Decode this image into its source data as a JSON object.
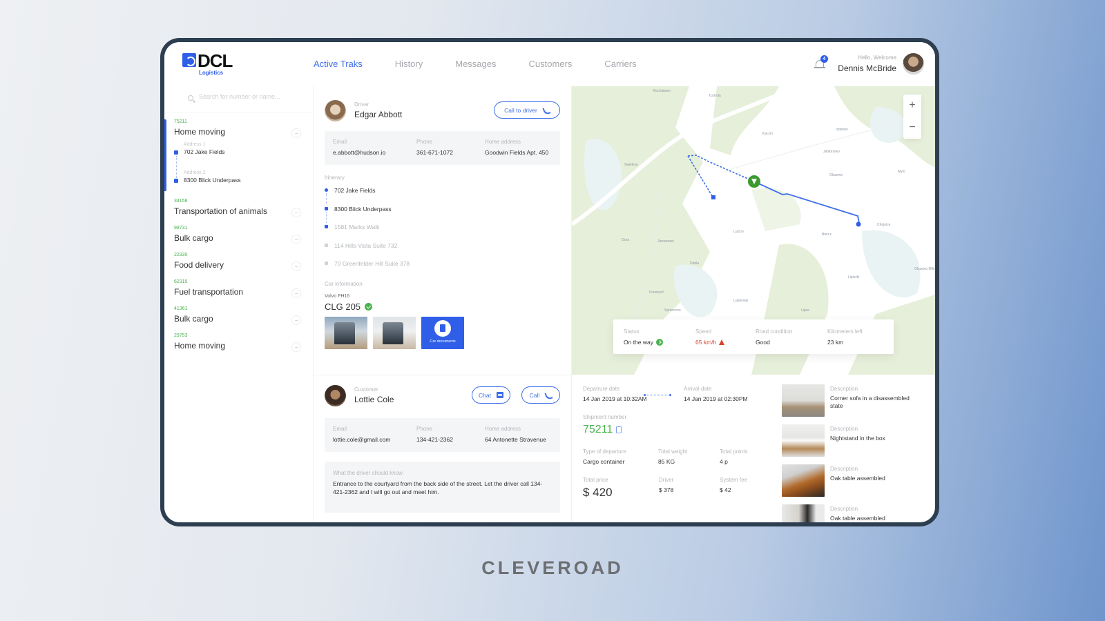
{
  "brand": {
    "logo_text": "DCL",
    "logo_sub": "Logistics",
    "footer": "CLEVEROAD"
  },
  "nav": {
    "items": [
      {
        "label": "Active Traks",
        "active": true
      },
      {
        "label": "History",
        "active": false
      },
      {
        "label": "Messages",
        "active": false
      },
      {
        "label": "Customers",
        "active": false
      },
      {
        "label": "Carriers",
        "active": false
      }
    ]
  },
  "user": {
    "notifications": "4",
    "greeting": "Hello, Welcome",
    "name": "Dennis McBride"
  },
  "sidebar": {
    "search_placeholder": "Search for number or name...",
    "trips": [
      {
        "number": "75211",
        "title": "Home moving",
        "active": true,
        "addresses": [
          {
            "label": "Address 1",
            "value": "702 Jake Fields"
          },
          {
            "label": "Address 2",
            "value": "8300 Blick Underpass"
          }
        ]
      },
      {
        "number": "34156",
        "title": "Transportation of animals"
      },
      {
        "number": "98731",
        "title": "Bulk cargo"
      },
      {
        "number": "22330",
        "title": "Food delivery"
      },
      {
        "number": "62315",
        "title": "Fuel transportation"
      },
      {
        "number": "41361",
        "title": "Bulk cargo"
      },
      {
        "number": "29753",
        "title": "Home moving"
      }
    ]
  },
  "driver": {
    "role": "Driver",
    "name": "Edgar Abbott",
    "call_label": "Call to driver",
    "email_label": "Email",
    "email": "e.abbott@hudson.io",
    "phone_label": "Phone",
    "phone": "361-671-1072",
    "address_label": "Home address",
    "address": "Goodwin Fields Apt. 450"
  },
  "itinerary": {
    "label": "Itinerary",
    "stops": [
      {
        "value": "702 Jake Fields",
        "state": "done"
      },
      {
        "value": "8300 Blick Underpass",
        "state": "done"
      },
      {
        "value": "1581 Marks Walk",
        "state": "next"
      },
      {
        "value": "114 Hills Vista Suite 732",
        "state": "pending"
      },
      {
        "value": "70 Greenfelder Hill Suite 378",
        "state": "pending"
      }
    ]
  },
  "car": {
    "label": "Car information",
    "model": "Volvo FH16",
    "plate": "CLG 205",
    "documents_label": "Car documents"
  },
  "customer": {
    "role": "Customer",
    "name": "Lottie Cole",
    "chat_label": "Chat",
    "call_label": "Call",
    "email_label": "Email",
    "email": "lottie.cole@gmail.com",
    "phone_label": "Phone",
    "phone": "134-421-2362",
    "address_label": "Home address",
    "address": "64 Antonette Stravenue",
    "note_label": "What the driver should know",
    "note": "Entrance to the courtyard from the back side of the street. Let the driver call 134-421-2362 and I will go out and meet him."
  },
  "map": {
    "zoom_in": "+",
    "zoom_out": "−",
    "places": [
      "Bochatowo",
      "Tuchola",
      "Kaczin",
      "Izdebno",
      "Jabłonowo",
      "Swiekow",
      "Olszewo",
      "Mylo",
      "Lulzon",
      "Biercz",
      "Chojnice",
      "Gora",
      "Jaroszewo",
      "Dobla",
      "Przemyśl",
      "Lubieniak",
      "Sprzeczno",
      "Lipiczki",
      "Lipce",
      "Olszewo Mile"
    ],
    "status": {
      "status_label": "Status",
      "status_value": "On the way",
      "speed_label": "Speed",
      "speed_value": "65 km/h",
      "road_label": "Road condition",
      "road_value": "Good",
      "km_label": "Kilometers left",
      "km_value": "23 km"
    }
  },
  "shipment": {
    "departure_label": "Depatrure date",
    "departure": "14 Jan 2019 at 10:32AM",
    "arrival_label": "Arrival date",
    "arrival": "14 Jan 2019 at 02:30PM",
    "number_label": "Shipment number",
    "number": "75211",
    "type_label": "Type of departure",
    "type": "Cargo container",
    "weight_label": "Total weight",
    "weight": "85 KG",
    "points_label": "Total points",
    "points": "4 p",
    "price_label": "Total price",
    "price": "$ 420",
    "driver_label": "Driver",
    "driver_fee": "$ 378",
    "fee_label": "System fee",
    "fee": "$ 42"
  },
  "cargo": {
    "items": [
      {
        "label": "Description",
        "desc": "Corner sofa in a disassembled state"
      },
      {
        "label": "Description",
        "desc": "Nightstand in the box"
      },
      {
        "label": "Description",
        "desc": "Oak table assembled"
      },
      {
        "label": "Description",
        "desc": "Oak table assembled"
      }
    ]
  },
  "colors": {
    "accent": "#3d6ee8",
    "brand_blue": "#2f5fe8",
    "success": "#47b34c",
    "danger": "#d4442f"
  }
}
